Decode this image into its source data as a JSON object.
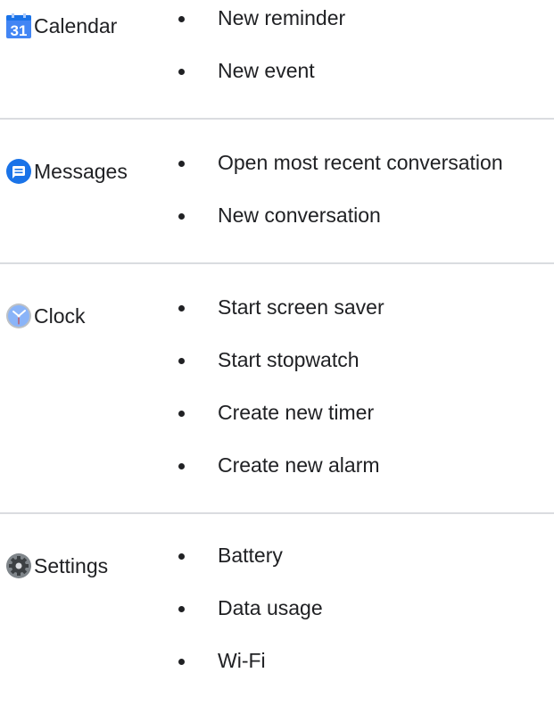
{
  "sections": [
    {
      "app_name": "Calendar",
      "icon": "calendar-icon",
      "icon_text": "31",
      "actions": [
        "New reminder",
        "New event"
      ]
    },
    {
      "app_name": "Messages",
      "icon": "messages-icon",
      "actions": [
        "Open most recent conversation",
        "New conversation"
      ]
    },
    {
      "app_name": "Clock",
      "icon": "clock-icon",
      "actions": [
        "Start screen saver",
        "Start stopwatch",
        "Create new timer",
        "Create new alarm"
      ]
    },
    {
      "app_name": "Settings",
      "icon": "settings-icon",
      "actions": [
        "Battery",
        "Data usage",
        "Wi-Fi"
      ]
    }
  ],
  "colors": {
    "calendar_blue": "#4285f4",
    "messages_blue": "#1a73e8",
    "clock_blue": "#8ab4f8",
    "settings_grey": "#5f6368",
    "divider": "#dadce0"
  }
}
